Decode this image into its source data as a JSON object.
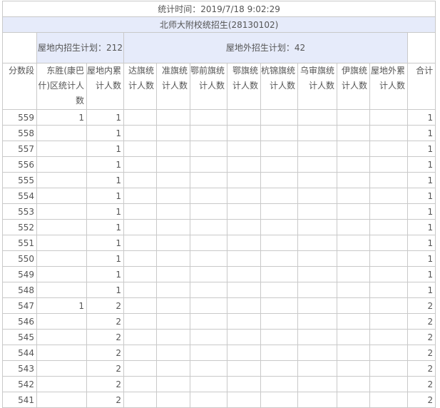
{
  "header": {
    "time": "统计时间：2019/7/18 9:02:29",
    "school": "北师大附校统招生(28130102)"
  },
  "plans": {
    "inside": "屋地内招生计划：212",
    "outside": "屋地外招生计划：42"
  },
  "columns": [
    "分数段",
    "东胜(康巴什)区统计人数",
    "屋地内累计人数",
    "达旗统计人数",
    "准旗统计人数",
    "鄂前旗统计人数",
    "鄂旗统计人数",
    "杭锦旗统计人数",
    "乌审旗统计人数",
    "伊旗统计人数",
    "屋地外累计人数",
    "合计"
  ],
  "rows": [
    {
      "score": "559",
      "dongsheng": "1",
      "inside_cum": "1",
      "total": "1"
    },
    {
      "score": "558",
      "dongsheng": "",
      "inside_cum": "1",
      "total": "1"
    },
    {
      "score": "557",
      "dongsheng": "",
      "inside_cum": "1",
      "total": "1"
    },
    {
      "score": "556",
      "dongsheng": "",
      "inside_cum": "1",
      "total": "1"
    },
    {
      "score": "555",
      "dongsheng": "",
      "inside_cum": "1",
      "total": "1"
    },
    {
      "score": "554",
      "dongsheng": "",
      "inside_cum": "1",
      "total": "1"
    },
    {
      "score": "553",
      "dongsheng": "",
      "inside_cum": "1",
      "total": "1"
    },
    {
      "score": "552",
      "dongsheng": "",
      "inside_cum": "1",
      "total": "1"
    },
    {
      "score": "551",
      "dongsheng": "",
      "inside_cum": "1",
      "total": "1"
    },
    {
      "score": "550",
      "dongsheng": "",
      "inside_cum": "1",
      "total": "1"
    },
    {
      "score": "549",
      "dongsheng": "",
      "inside_cum": "1",
      "total": "1"
    },
    {
      "score": "548",
      "dongsheng": "",
      "inside_cum": "1",
      "total": "1"
    },
    {
      "score": "547",
      "dongsheng": "1",
      "inside_cum": "2",
      "total": "2"
    },
    {
      "score": "546",
      "dongsheng": "",
      "inside_cum": "2",
      "total": "2"
    },
    {
      "score": "545",
      "dongsheng": "",
      "inside_cum": "2",
      "total": "2"
    },
    {
      "score": "544",
      "dongsheng": "",
      "inside_cum": "2",
      "total": "2"
    },
    {
      "score": "543",
      "dongsheng": "",
      "inside_cum": "2",
      "total": "2"
    },
    {
      "score": "542",
      "dongsheng": "",
      "inside_cum": "2",
      "total": "2"
    },
    {
      "score": "541",
      "dongsheng": "",
      "inside_cum": "2",
      "total": "2"
    }
  ]
}
